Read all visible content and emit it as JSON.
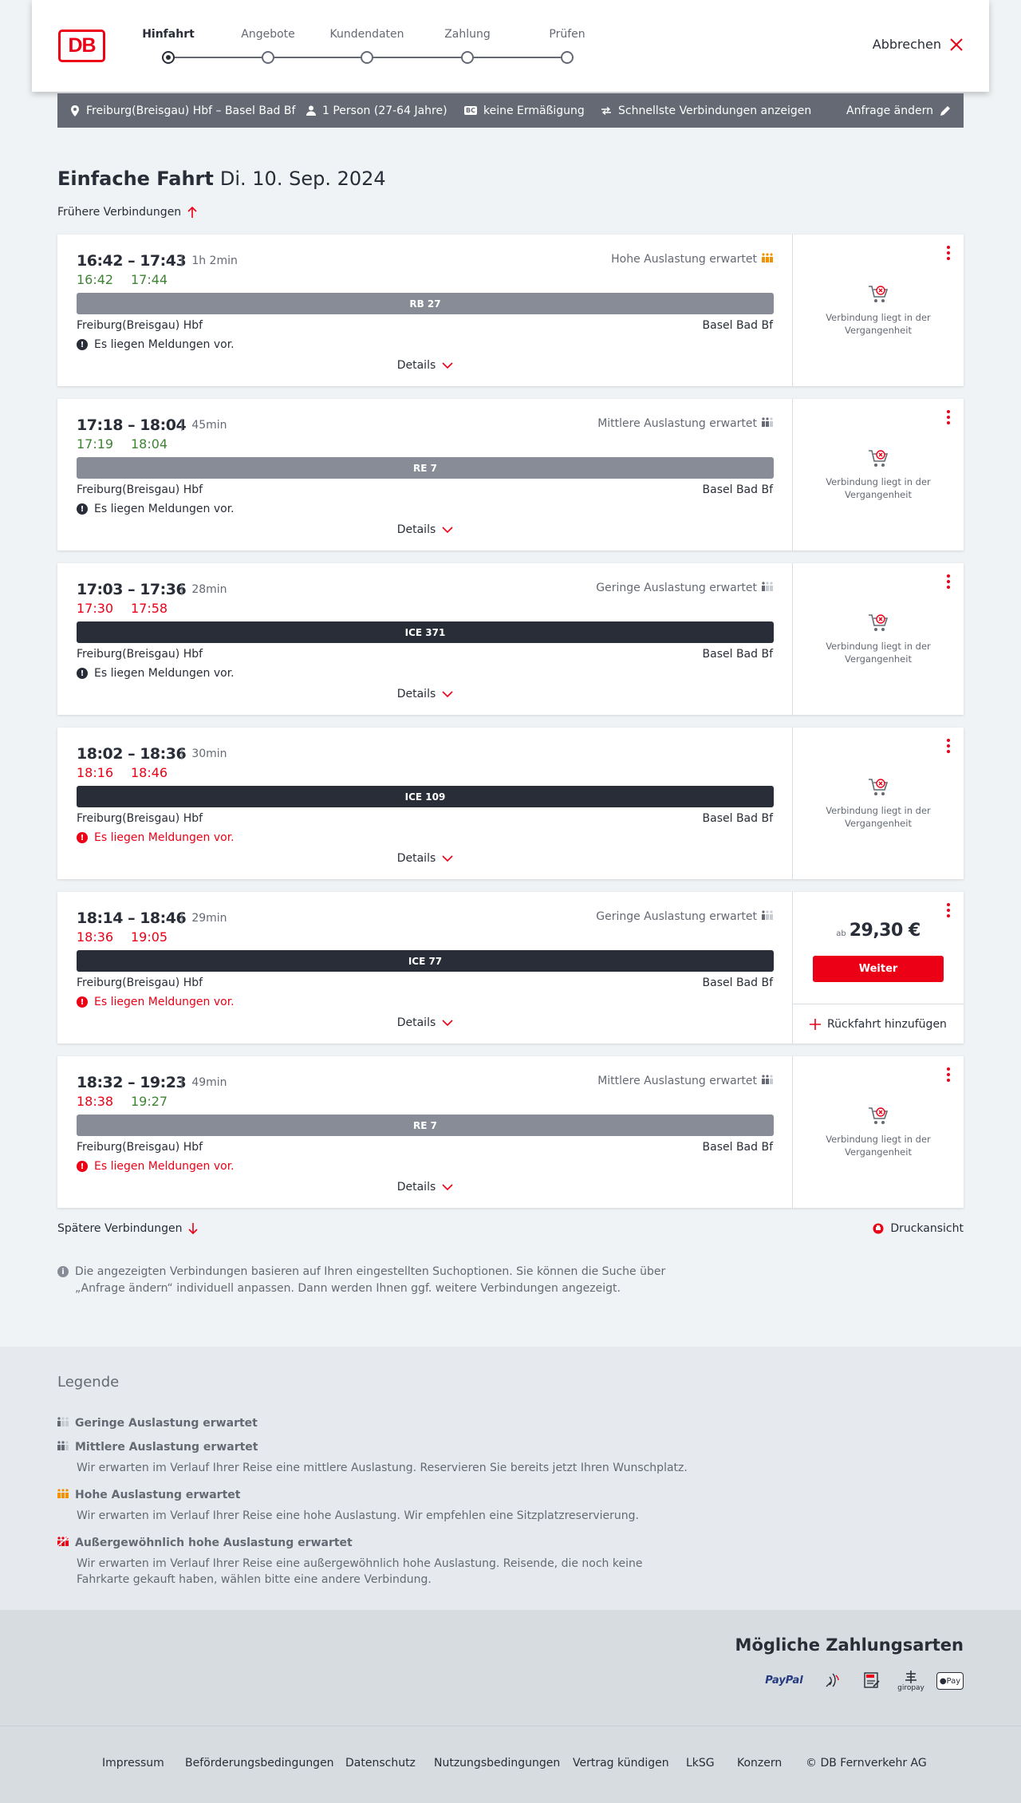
{
  "header": {
    "logo_text": "DB",
    "steps": [
      "Hinfahrt",
      "Angebote",
      "Kundendaten",
      "Zahlung",
      "Prüfen"
    ],
    "active_step": 0,
    "abort_label": "Abbrechen"
  },
  "search_bar": {
    "route": "Freiburg(Breisgau) Hbf – Basel Bad Bf",
    "persons": "1 Person (27-64 Jahre)",
    "discount_badge": "BC",
    "discount": "keine Ermäßigung",
    "fastest": "Schnellste Verbindungen anzeigen",
    "change": "Anfrage ändern"
  },
  "title": {
    "trip_type": "Einfache Fahrt",
    "date": "Di. 10. Sep. 2024"
  },
  "earlier_label": "Frühere Verbindungen",
  "later_label": "Spätere Verbindungen",
  "print_label": "Druckansicht",
  "connections": [
    {
      "times": "16:42 – 17:43",
      "duration": "1h 2min",
      "rt_dep": "16:42",
      "rt_dep_status": "green",
      "rt_arr": "17:44",
      "rt_arr_status": "green",
      "load": "Hohe Auslastung erwartet",
      "load_level": "high",
      "train": "RB 27",
      "train_kind": "regio",
      "from": "Freiburg(Breisgau) Hbf",
      "to": "Basel Bad Bf",
      "message": "Es liegen Meldungen vor.",
      "message_alert": false,
      "details": "Details",
      "status": "Verbindung liegt in der Vergangenheit"
    },
    {
      "times": "17:18 – 18:04",
      "duration": "45min",
      "rt_dep": "17:19",
      "rt_dep_status": "green",
      "rt_arr": "18:04",
      "rt_arr_status": "green",
      "load": "Mittlere Auslastung erwartet",
      "load_level": "medium",
      "train": "RE 7",
      "train_kind": "regio",
      "from": "Freiburg(Breisgau) Hbf",
      "to": "Basel Bad Bf",
      "message": "Es liegen Meldungen vor.",
      "message_alert": false,
      "details": "Details",
      "status": "Verbindung liegt in der Vergangenheit"
    },
    {
      "times": "17:03 – 17:36",
      "duration": "28min",
      "rt_dep": "17:30",
      "rt_dep_status": "red",
      "rt_arr": "17:58",
      "rt_arr_status": "red",
      "load": "Geringe Auslastung erwartet",
      "load_level": "low",
      "train": "ICE 371",
      "train_kind": "ice",
      "from": "Freiburg(Breisgau) Hbf",
      "to": "Basel Bad Bf",
      "message": "Es liegen Meldungen vor.",
      "message_alert": false,
      "details": "Details",
      "status": "Verbindung liegt in der Vergangenheit"
    },
    {
      "times": "18:02 – 18:36",
      "duration": "30min",
      "rt_dep": "18:16",
      "rt_dep_status": "red",
      "rt_arr": "18:46",
      "rt_arr_status": "red",
      "load": "",
      "load_level": "",
      "train": "ICE 109",
      "train_kind": "ice",
      "from": "Freiburg(Breisgau) Hbf",
      "to": "Basel Bad Bf",
      "message": "Es liegen Meldungen vor.",
      "message_alert": true,
      "details": "Details",
      "status": "Verbindung liegt in der Vergangenheit"
    },
    {
      "times": "18:14 – 18:46",
      "duration": "29min",
      "rt_dep": "18:36",
      "rt_dep_status": "red",
      "rt_arr": "19:05",
      "rt_arr_status": "red",
      "load": "Geringe Auslastung erwartet",
      "load_level": "low",
      "train": "ICE 77",
      "train_kind": "ice",
      "from": "Freiburg(Breisgau) Hbf",
      "to": "Basel Bad Bf",
      "message": "Es liegen Meldungen vor.",
      "message_alert": true,
      "details": "Details",
      "price_prefix": "ab",
      "price": "29,30 €",
      "button": "Weiter",
      "return_label": "Rückfahrt hinzufügen"
    },
    {
      "times": "18:32 – 19:23",
      "duration": "49min",
      "rt_dep": "18:38",
      "rt_dep_status": "red",
      "rt_arr": "19:27",
      "rt_arr_status": "green",
      "load": "Mittlere Auslastung erwartet",
      "load_level": "medium",
      "train": "RE 7",
      "train_kind": "regio",
      "from": "Freiburg(Breisgau) Hbf",
      "to": "Basel Bad Bf",
      "message": "Es liegen Meldungen vor.",
      "message_alert": true,
      "details": "Details",
      "status": "Verbindung liegt in der Vergangenheit"
    }
  ],
  "info_text": "Die angezeigten Verbindungen basieren auf Ihren eingestellten Suchoptionen. Sie können die Suche über „Anfrage ändern“ individuell anpassen. Dann werden Ihnen ggf. weitere Verbindungen angezeigt.",
  "legend": {
    "title": "Legende",
    "items": [
      {
        "level": "low",
        "title": "Geringe Auslastung erwartet",
        "desc": ""
      },
      {
        "level": "medium",
        "title": "Mittlere Auslastung erwartet",
        "desc": "Wir erwarten im Verlauf Ihrer Reise eine mittlere Auslastung. Reservieren Sie bereits jetzt Ihren Wunschplatz."
      },
      {
        "level": "high",
        "title": "Hohe Auslastung erwartet",
        "desc": "Wir erwarten im Verlauf Ihrer Reise eine hohe Auslastung. Wir empfehlen eine Sitzplatzreservierung."
      },
      {
        "level": "extreme",
        "title": "Außergewöhnlich hohe Auslastung erwartet",
        "desc": "Wir erwarten im Verlauf Ihrer Reise eine außergewöhnlich hohe Auslastung. Reisende, die noch keine Fahrkarte gekauft haben, wählen bitte eine andere Verbindung."
      }
    ]
  },
  "payment": {
    "title": "Mögliche Zahlungsarten",
    "methods": [
      "PayPal",
      "giropay",
      "Pay"
    ]
  },
  "footer": {
    "links": [
      "Impressum",
      "Beförderungsbedingungen",
      "Datenschutz",
      "Nutzungsbedingungen",
      "Vertrag kündigen",
      "LkSG",
      "Konzern",
      "© DB Fernverkehr AG"
    ]
  },
  "colors": {
    "brand_red": "#ec0016",
    "delay_red": "#ec0016",
    "ontime_green": "#408335",
    "bar_gray": "#646973",
    "ice_dark": "#282d37",
    "high_load_orange": "#f39200"
  }
}
